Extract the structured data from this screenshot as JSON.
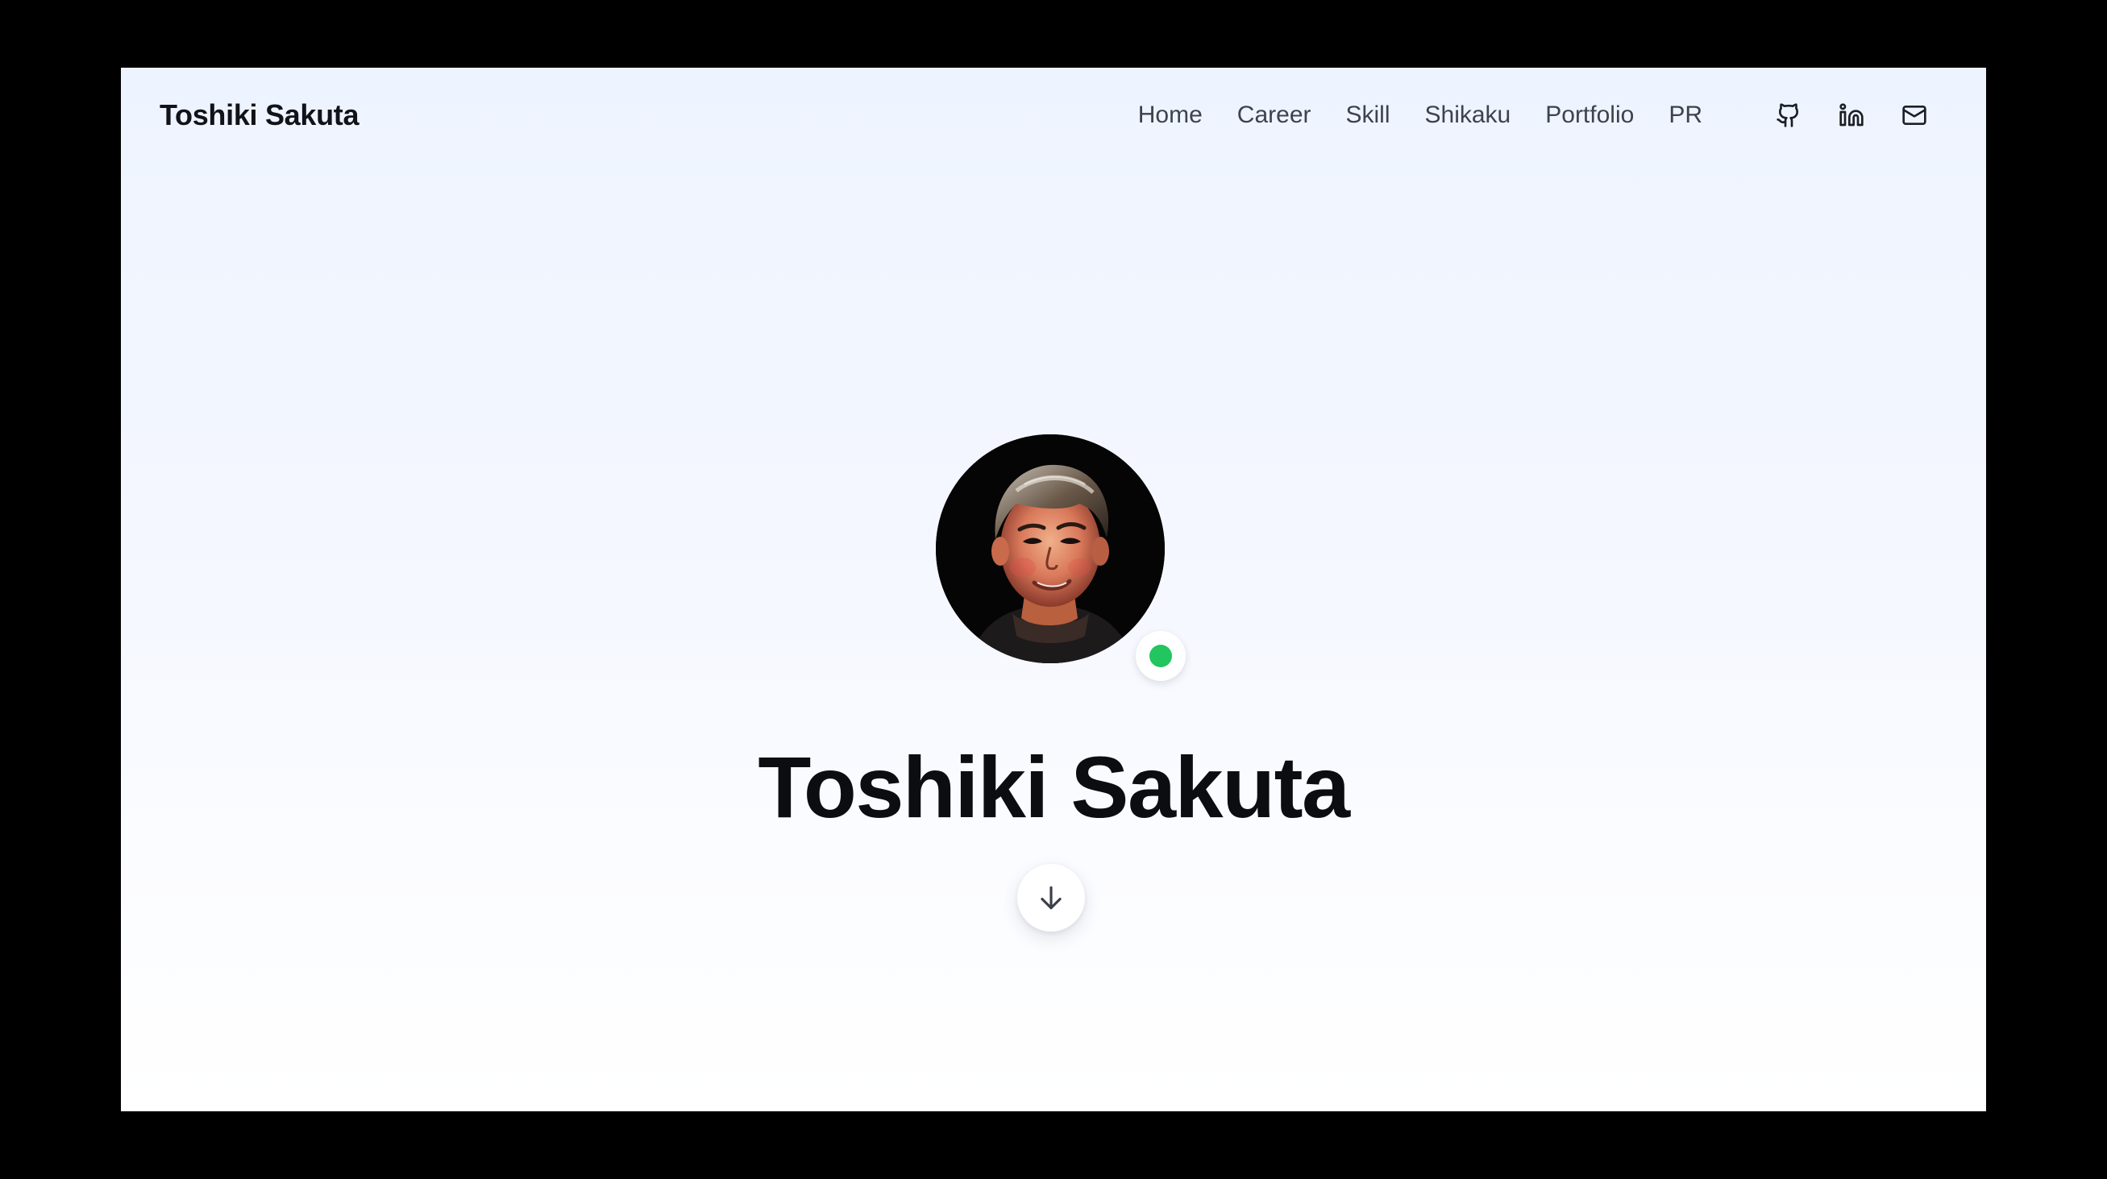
{
  "header": {
    "brand": "Toshiki Sakuta",
    "nav": [
      {
        "label": "Home"
      },
      {
        "label": "Career"
      },
      {
        "label": "Skill"
      },
      {
        "label": "Shikaku"
      },
      {
        "label": "Portfolio"
      },
      {
        "label": "PR"
      }
    ],
    "social_icons": [
      "github-icon",
      "linkedin-icon",
      "mail-icon"
    ]
  },
  "hero": {
    "name": "Toshiki Sakuta",
    "status": "online",
    "status_color": "#22c55e",
    "scroll_icon": "arrow-down-icon"
  },
  "colors": {
    "text": "#0c0d10",
    "nav_text": "#3d424c",
    "background_top": "#eef4ff",
    "background_bottom": "#ffffff"
  }
}
